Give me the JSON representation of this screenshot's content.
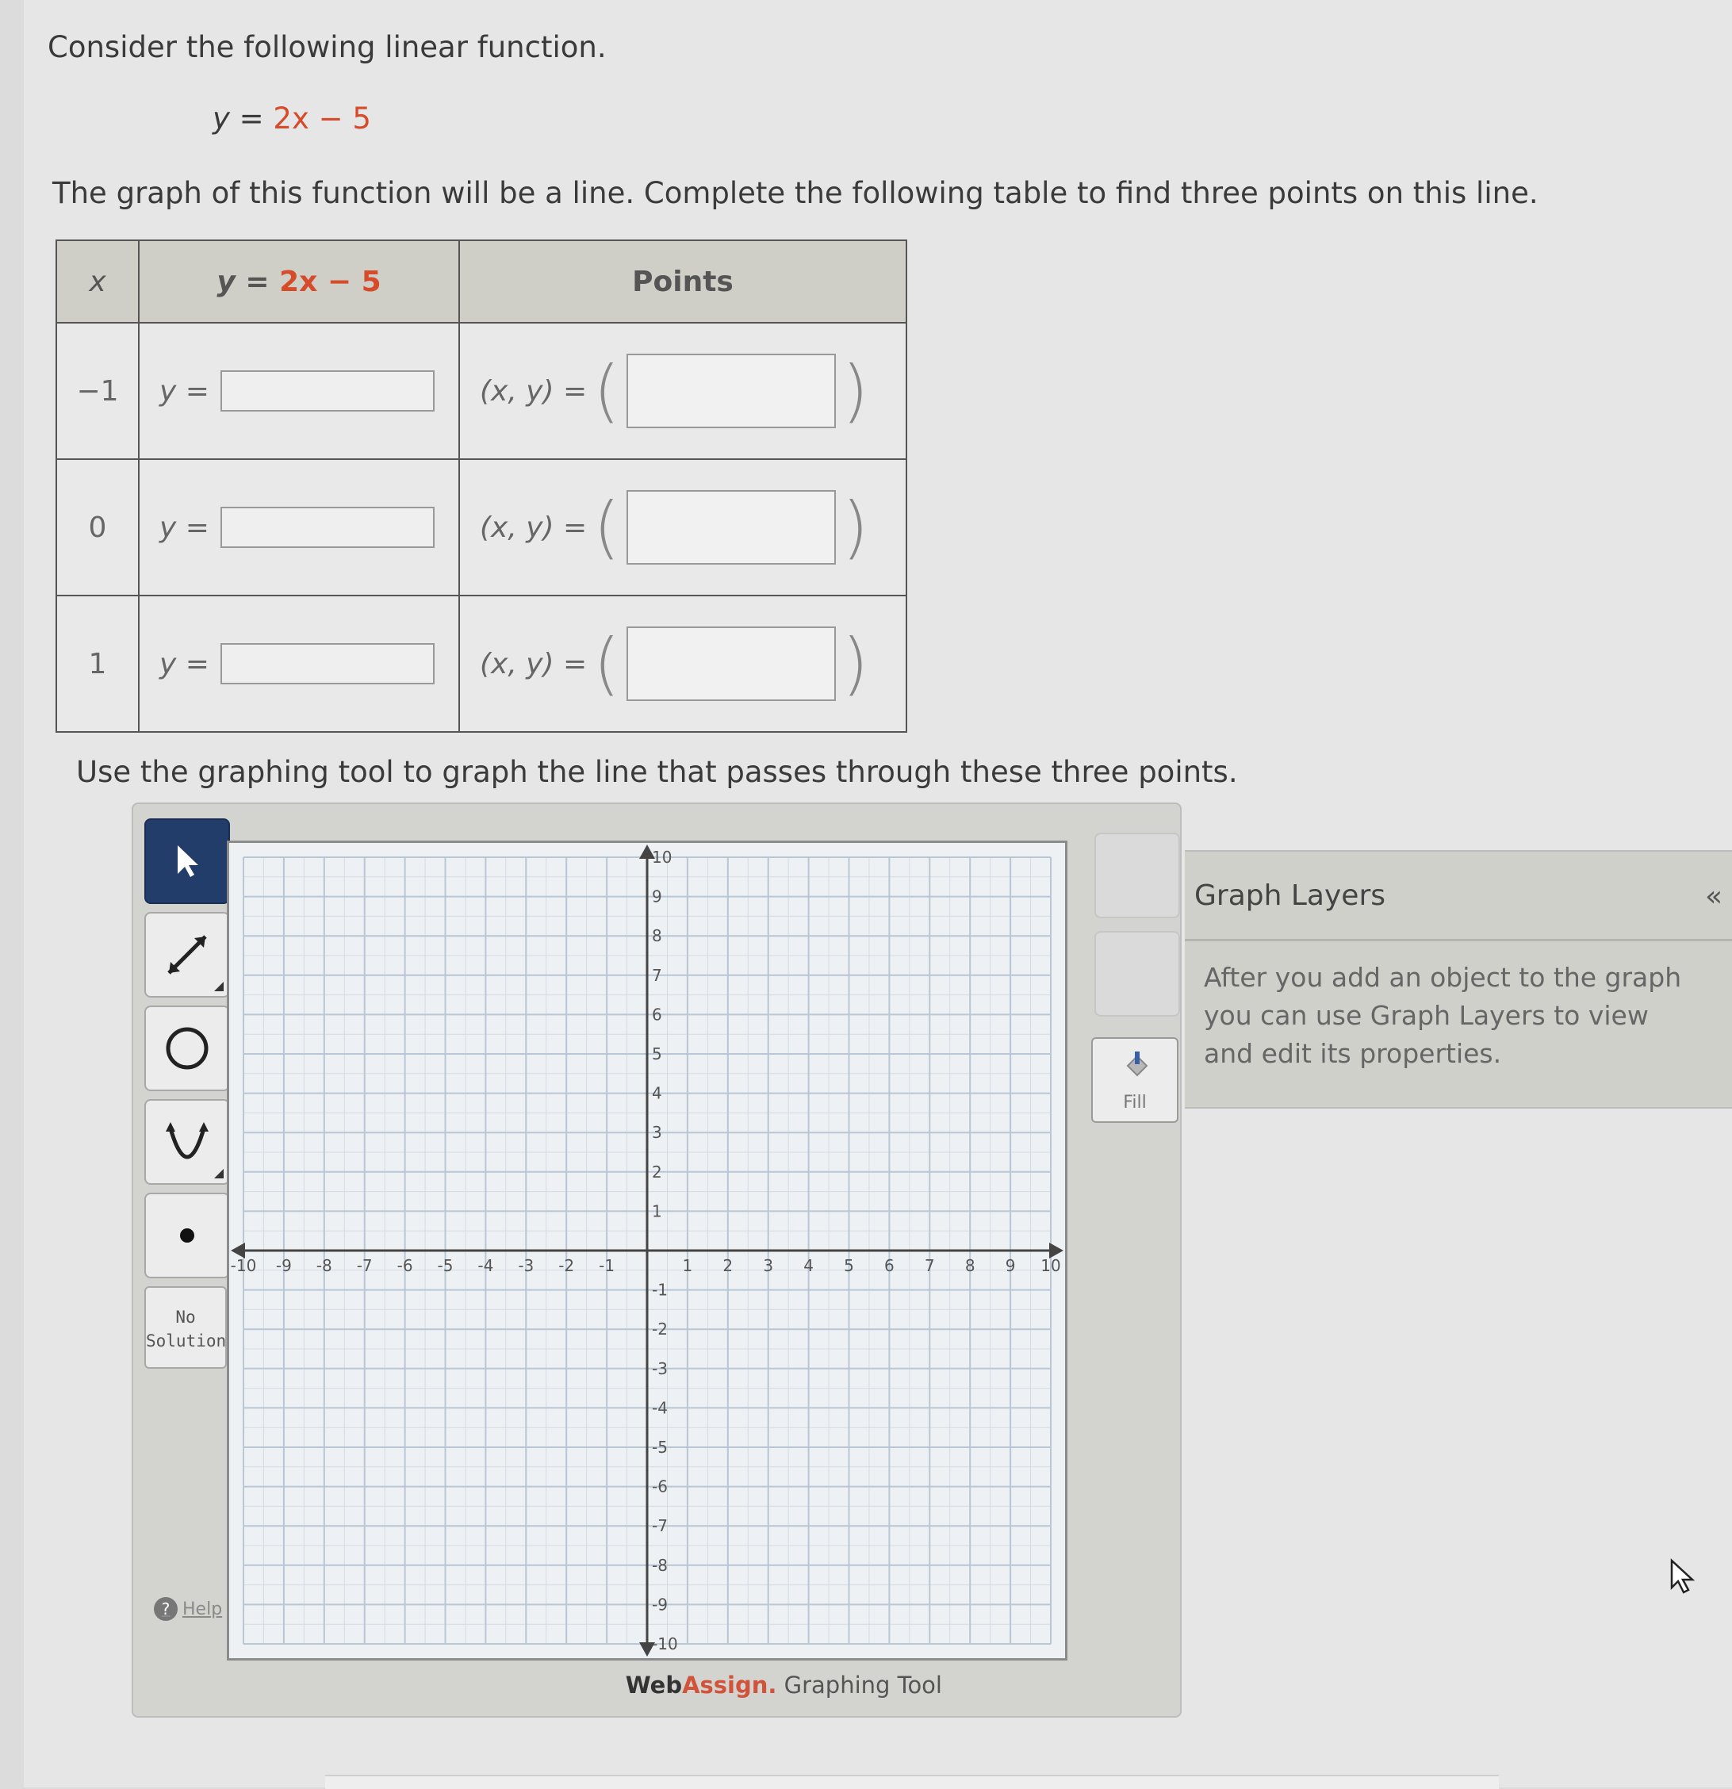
{
  "question": {
    "intro": "Consider the following linear function.",
    "equation_prefix": "y = ",
    "equation_expr": "2x − 5",
    "description": "The graph of this function will be a line. Complete the following table to find three points on this line."
  },
  "table": {
    "headers": {
      "x": "x",
      "y_prefix": "y = ",
      "y_expr": "2x − 5",
      "points": "Points"
    },
    "y_label": "y =",
    "point_label": "(x, y) =",
    "open_paren": "(",
    "close_paren": ")",
    "rows": [
      {
        "x": "−1",
        "y_value": "",
        "point_value": ""
      },
      {
        "x": "0",
        "y_value": "",
        "point_value": ""
      },
      {
        "x": "1",
        "y_value": "",
        "point_value": ""
      }
    ]
  },
  "instruction": "Use the graphing tool to graph the line that passes through these three points.",
  "graph_tool": {
    "tools": [
      "pointer-tool",
      "line-tool",
      "circle-tool",
      "parabola-tool",
      "point-tool"
    ],
    "no_solution_line1": "No",
    "no_solution_line2": "Solution",
    "help_label": "Help",
    "fill_label": "Fill",
    "brand_web": "Web",
    "brand_assign": "Assign.",
    "brand_rest": " Graphing Tool",
    "colors": {
      "active_tool": "#233d6a",
      "grid_line": "#b9c6d3",
      "axis": "#444444"
    }
  },
  "chart_data": {
    "type": "scatter",
    "x": [],
    "y": [],
    "xlim": [
      -10,
      10
    ],
    "ylim": [
      -10,
      10
    ],
    "x_ticks": [
      -10,
      -9,
      -8,
      -7,
      -6,
      -5,
      -4,
      -3,
      -2,
      -1,
      1,
      2,
      3,
      4,
      5,
      6,
      7,
      8,
      9,
      10
    ],
    "y_ticks": [
      -10,
      -9,
      -8,
      -7,
      -6,
      -5,
      -4,
      -3,
      -2,
      -1,
      1,
      2,
      3,
      4,
      5,
      6,
      7,
      8,
      9,
      10
    ],
    "grid": true,
    "minor_grid": true
  },
  "graph_layers": {
    "title": "Graph Layers",
    "collapse_icon": "«",
    "message": "After you add an object to the graph you can use Graph Layers to view and edit its properties."
  }
}
